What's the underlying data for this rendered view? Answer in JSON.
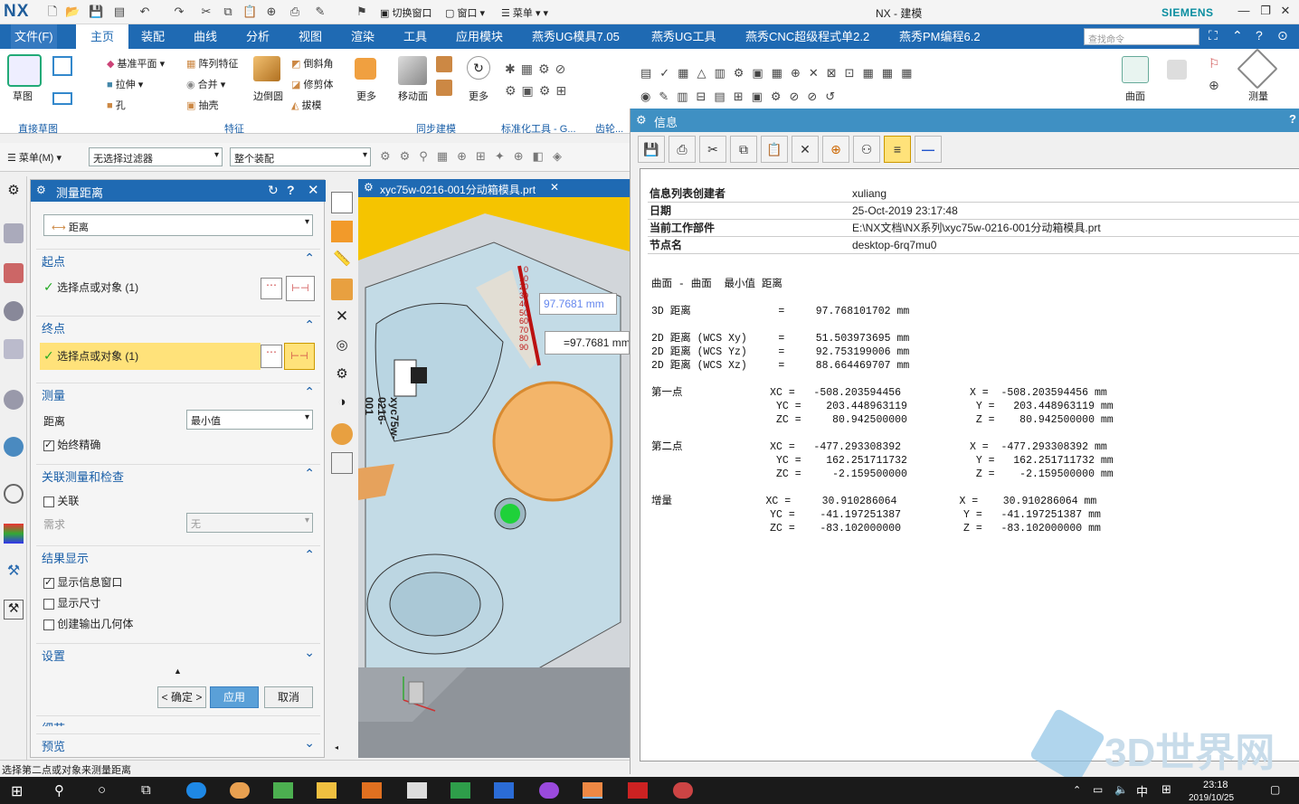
{
  "app": {
    "logo": "NX",
    "title": "NX - 建模",
    "brand": "SIEMENS",
    "quick_switch": "切换窗口",
    "window_menu": "窗口",
    "menu_label": "菜单"
  },
  "menubar": {
    "file": "文件(F)",
    "tabs": [
      "主页",
      "装配",
      "曲线",
      "分析",
      "视图",
      "渲染",
      "工具",
      "应用模块",
      "燕秀UG模具7.05",
      "燕秀UG工具",
      "燕秀CNC超级程式单2.2",
      "燕秀PM编程6.2"
    ],
    "search_placeholder": "查找命令"
  },
  "ribbon": {
    "sketch": "草图",
    "group_direct_sketch": "直接草图",
    "feature_items": [
      "基准平面",
      "拉伸",
      "孔",
      "阵列特征",
      "合并",
      "抽壳",
      "边倒圆",
      "倒斜角",
      "修剪体",
      "拔模",
      "更多"
    ],
    "group_feature": "特征",
    "sync": [
      "移动面",
      "更多"
    ],
    "group_sync": "同步建模",
    "group_std": "标准化工具 - G...",
    "group_gear": "齿轮...",
    "right_labels": [
      "曲面",
      "测量"
    ]
  },
  "toolbar2": {
    "menu": "菜单(M)",
    "filter": "无选择过滤器",
    "scope": "整个装配"
  },
  "dialog": {
    "title": "测量距离",
    "type": "距离",
    "start_section": "起点",
    "start_select": "选择点或对象 (1)",
    "end_section": "终点",
    "end_select": "选择点或对象 (1)",
    "measure_section": "测量",
    "distance_label": "距离",
    "distance_value": "最小值",
    "always_precise": "始终精确",
    "assoc_section": "关联测量和检查",
    "assoc": "关联",
    "req_label": "需求",
    "req_value": "无",
    "result_section": "结果显示",
    "show_info": "显示信息窗口",
    "show_dim": "显示尺寸",
    "create_geom": "创建输出几何体",
    "settings_section": "设置",
    "ok": "< 确定 >",
    "apply": "应用",
    "cancel": "取消",
    "detail": "细节",
    "preview": "预览"
  },
  "viewport": {
    "tab": "xyc75w-0216-001分动箱模具.prt",
    "measure_label": "97.7681 mm",
    "dim_label": "=97.7681 mm",
    "ruler_ticks": [
      "0",
      "10",
      "20",
      "30",
      "40",
      "50",
      "60",
      "70",
      "80",
      "90"
    ],
    "part_text": "xyc75w-0216-001"
  },
  "info": {
    "title": "信息",
    "header_rows": [
      {
        "k": "信息列表创建者",
        "v": "xuliang"
      },
      {
        "k": "日期",
        "v": "25-Oct-2019 23:17:48"
      },
      {
        "k": "当前工作部件",
        "v": "E:\\NX文档\\NX系列\\xyc75w-0216-001分动箱模具.prt"
      },
      {
        "k": "节点名",
        "v": "desktop-6rq7mu0"
      }
    ],
    "body_lines": [
      "曲面 - 曲面  最小值 距离",
      "",
      "3D 距离              =     97.768101702 mm",
      "",
      "2D 距离 (WCS Xy)     =     51.503973695 mm",
      "2D 距离 (WCS Yz)     =     92.753199006 mm",
      "2D 距离 (WCS Xz)     =     88.664469707 mm",
      "",
      "第一点              XC =   -508.203594456           X =  -508.203594456 mm",
      "                    YC =    203.448963119           Y =   203.448963119 mm",
      "                    ZC =     80.942500000           Z =    80.942500000 mm",
      "",
      "第二点              XC =   -477.293308392           X =  -477.293308392 mm",
      "                    YC =    162.251711732           Y =   162.251711732 mm",
      "                    ZC =     -2.159500000           Z =    -2.159500000 mm",
      "",
      "增量               XC =     30.910286064          X =    30.910286064 mm",
      "                   YC =    -41.197251387          Y =   -41.197251387 mm",
      "                   ZC =    -83.102000000          Z =   -83.102000000 mm"
    ]
  },
  "status": "选择第二点或对象来测量距离",
  "taskbar": {
    "time": "23:18",
    "date": "2019/10/25",
    "ime": "中"
  },
  "watermark": "3D世界网",
  "colors": {
    "accent": "#1f6ab3",
    "info_header": "#3f90c3",
    "highlight": "#ffe27a",
    "viewport_yellow": "#f5c400"
  }
}
